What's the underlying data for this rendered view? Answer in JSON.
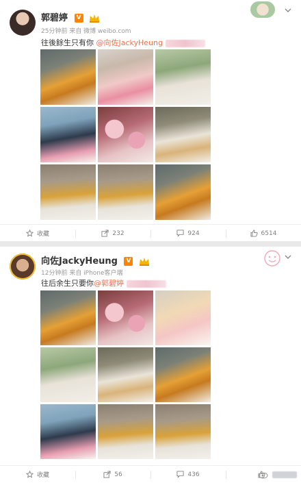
{
  "posts": [
    {
      "author": "郭碧婷",
      "meta": "25分钟前 来自 微博 weibo.com",
      "caption_text": "往後餘生只有你",
      "mention": "@向佐JackyHeung",
      "photos": [
        "car",
        "portrait",
        "garden",
        "umbrella",
        "flowers",
        "couple",
        "castle",
        "castle",
        "car"
      ],
      "actions": [
        {
          "icon": "star-icon",
          "label": "收藏"
        },
        {
          "icon": "share-icon",
          "label": "232"
        },
        {
          "icon": "comment-icon",
          "label": "924"
        },
        {
          "icon": "like-icon",
          "label": "6514"
        }
      ]
    },
    {
      "author": "向佐JackyHeung",
      "meta": "12分钟前 来自 iPhone客户端",
      "caption_text": "往后余生只要你",
      "mention": "@郭碧婷",
      "photos": [
        "portrait",
        "flowers",
        "bright",
        "garden",
        "couple",
        "car",
        "umbrella",
        "castle",
        "castle"
      ],
      "actions": [
        {
          "icon": "star-icon",
          "label": "收藏"
        },
        {
          "icon": "share-icon",
          "label": "56"
        },
        {
          "icon": "comment-icon",
          "label": "436"
        },
        {
          "icon": "like-icon",
          "label": ""
        }
      ]
    }
  ],
  "colors": {
    "accent": "#eb7350",
    "verified": "#ff8200",
    "text": "#333333",
    "meta": "#999999"
  }
}
